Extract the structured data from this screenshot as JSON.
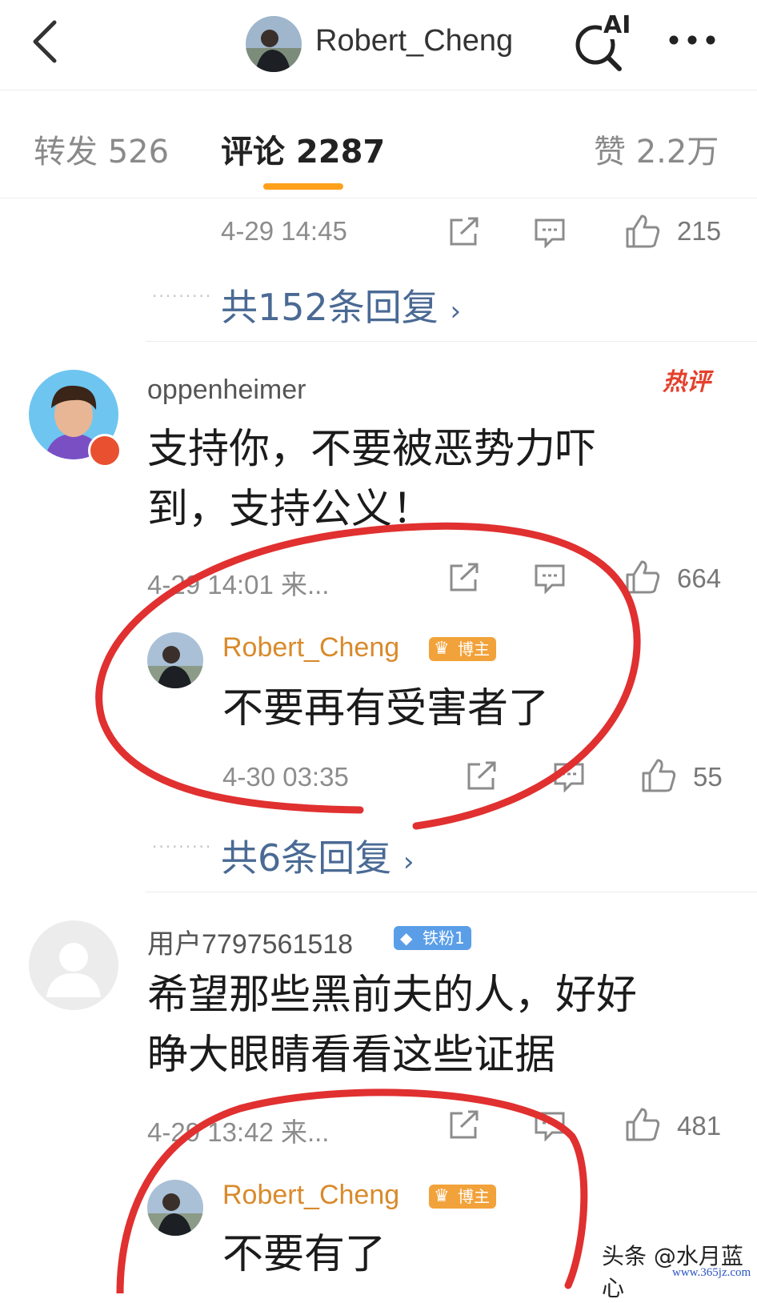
{
  "header": {
    "title": "Robert_Cheng",
    "ai_label": "AI",
    "back_icon": "chevron-left-icon",
    "more_icon": "more-horizontal-icon"
  },
  "tabs": [
    {
      "label": "转发 526"
    },
    {
      "label": "评论 2287",
      "active": true
    },
    {
      "label": "赞 2.2万"
    }
  ],
  "accent_color": "#ffa01b",
  "link_color": "#4a6a94",
  "annotation_color": "#e03030",
  "top_comment": {
    "time": "4-29 14:45",
    "likes": "215",
    "replies": "共152条回复"
  },
  "comments": [
    {
      "user": "oppenheimer",
      "hot_label": "热评",
      "text_line1": "支持你，不要被恶势力吓",
      "text_line2": "到，支持公义！",
      "meta": "4-29 14:01 来...",
      "likes": "664",
      "reply": {
        "user": "Robert_Cheng",
        "badge": "博主",
        "text": "不要再有受害者了",
        "time": "4-30 03:35",
        "likes": "55"
      },
      "replies": "共6条回复"
    },
    {
      "user": "用户7797561518",
      "badge": "铁粉1",
      "text_line1": "希望那些黑前夫的人，好好",
      "text_line2": "睁大眼睛看看这些证据",
      "meta": "4-29 13:42 来...",
      "likes": "481",
      "reply": {
        "user": "Robert_Cheng",
        "badge": "博主",
        "text": "不要有了"
      }
    }
  ],
  "watermark": {
    "line1": "头条 @水月蓝心",
    "line2": "www.365jz.com"
  }
}
